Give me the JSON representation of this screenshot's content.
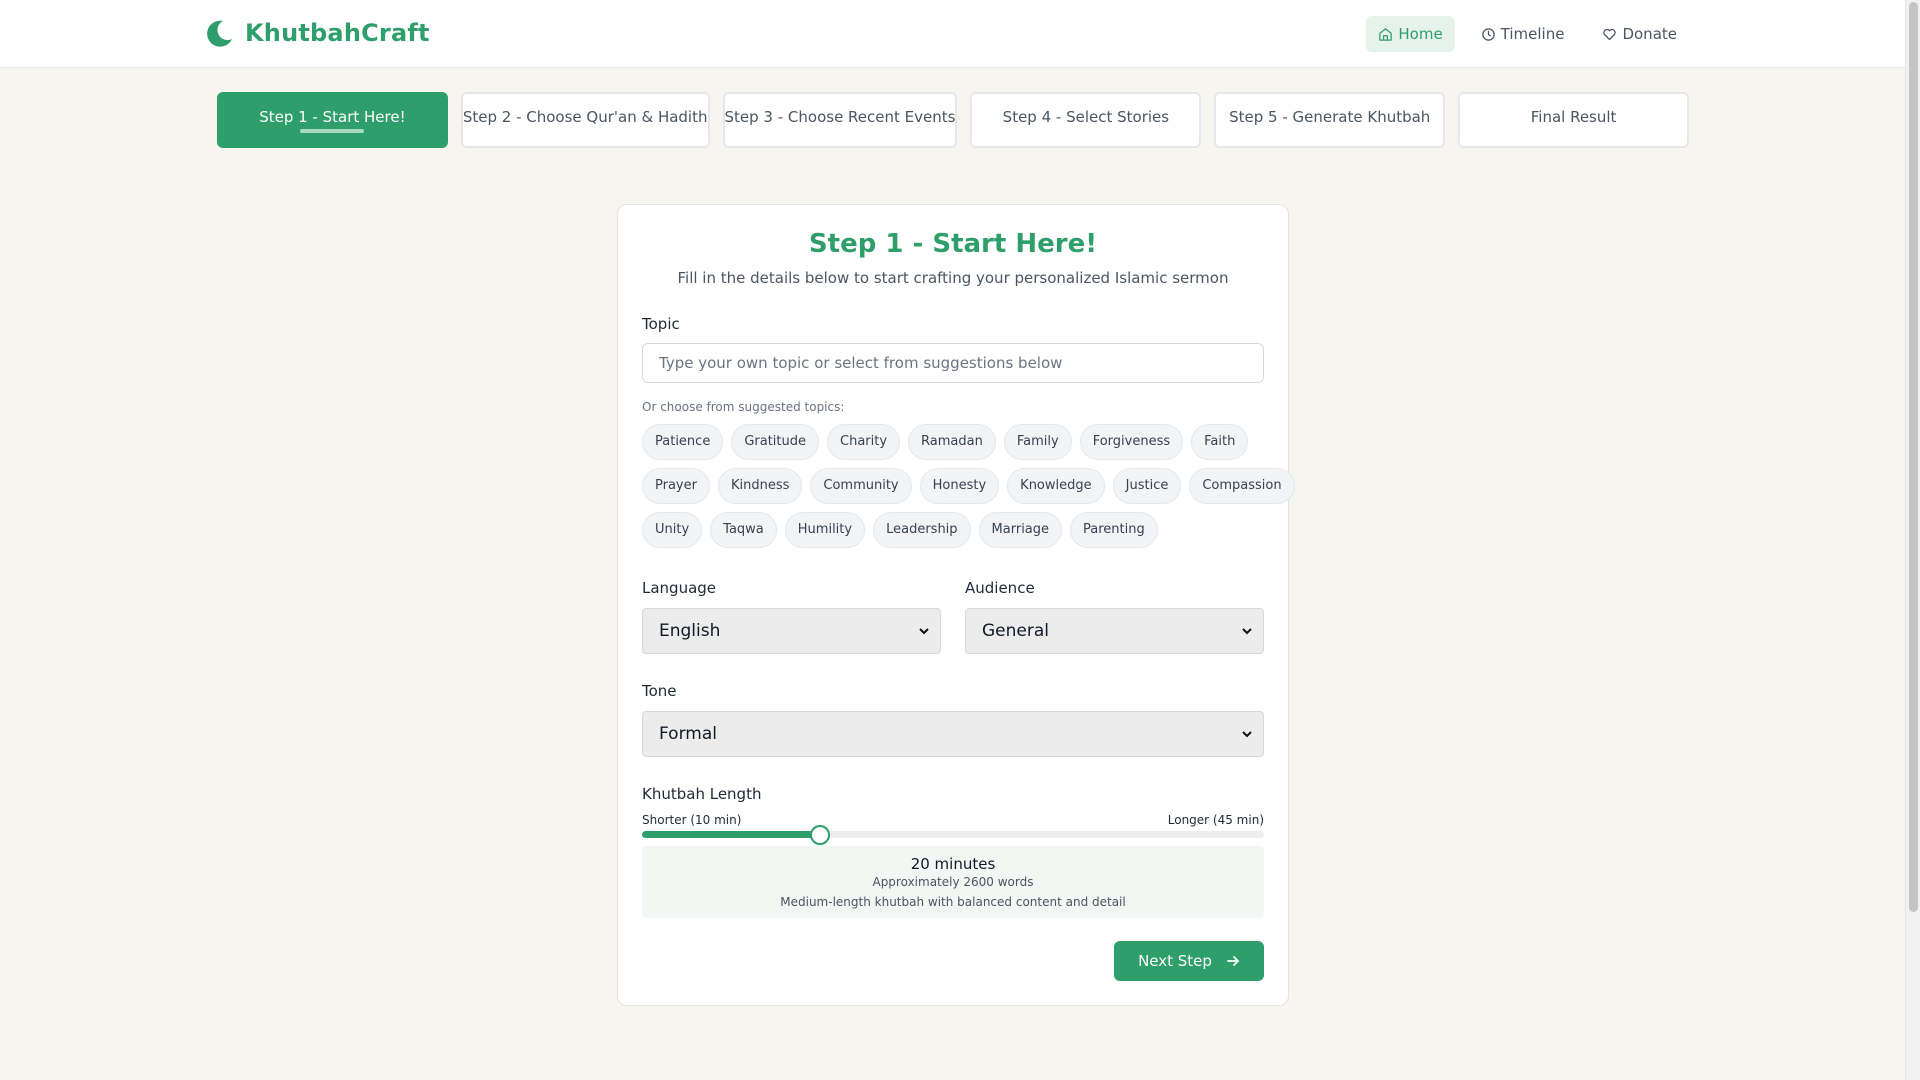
{
  "brand": {
    "name": "KhutbahCraft",
    "logo_icon": "crescent-moon-icon",
    "accent": "#2e9e6a"
  },
  "nav": [
    {
      "label": "Home",
      "icon": "home-icon",
      "active": true
    },
    {
      "label": "Timeline",
      "icon": "clock-icon",
      "active": false
    },
    {
      "label": "Donate",
      "icon": "heart-icon",
      "active": false
    }
  ],
  "steps": [
    {
      "label": "Step 1 - Start Here!",
      "active": true
    },
    {
      "label": "Step 2 - Choose Qur'an & Hadith",
      "active": false
    },
    {
      "label": "Step 3 - Choose Recent Events",
      "active": false
    },
    {
      "label": "Step 4 - Select Stories",
      "active": false
    },
    {
      "label": "Step 5 - Generate Khutbah",
      "active": false
    },
    {
      "label": "Final Result",
      "active": false
    }
  ],
  "form": {
    "title": "Step 1 - Start Here!",
    "subtitle": "Fill in the details below to start crafting your personalized Islamic sermon",
    "topic_label": "Topic",
    "topic_value": "",
    "topic_placeholder": "Type your own topic or select from suggestions below",
    "suggest_label": "Or choose from suggested topics:",
    "topic_rows": [
      [
        "Patience",
        "Gratitude",
        "Charity",
        "Ramadan",
        "Family",
        "Forgiveness",
        "Faith"
      ],
      [
        "Prayer",
        "Kindness",
        "Community",
        "Honesty",
        "Knowledge",
        "Justice",
        "Compassion"
      ],
      [
        "Unity",
        "Taqwa",
        "Humility",
        "Leadership",
        "Marriage",
        "Parenting"
      ]
    ],
    "language_label": "Language",
    "language_value": "English",
    "audience_label": "Audience",
    "audience_value": "General",
    "tone_label": "Tone",
    "tone_value": "Formal",
    "length_label": "Khutbah Length",
    "length_min_label": "Shorter (10 min)",
    "length_max_label": "Longer (45 min)",
    "length_min": 10,
    "length_max": 45,
    "length_value": 20,
    "length_minutes_text": "20 minutes",
    "length_words_text": "Approximately 2600 words",
    "length_desc_text": "Medium-length khutbah with balanced content and detail",
    "next_label": "Next Step",
    "next_icon": "arrow-right-icon"
  }
}
